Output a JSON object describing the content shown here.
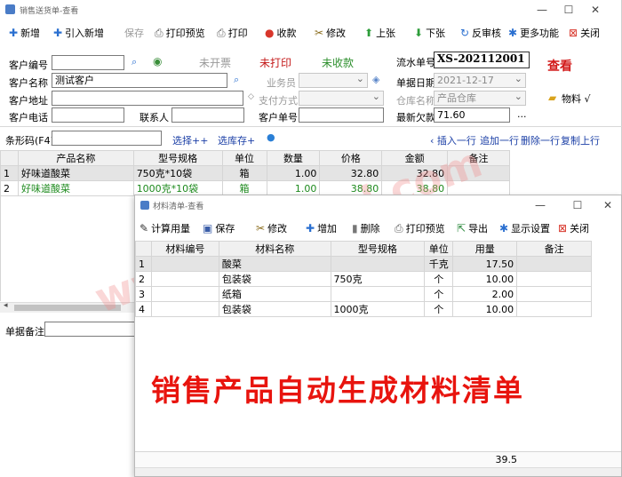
{
  "main_window": {
    "title": "销售送货单-查看",
    "toolbar": {
      "new": "新增",
      "import_new": "引入新增",
      "save": "保存",
      "print_preview": "打印预览",
      "print": "打印",
      "receive": "收款",
      "edit": "修改",
      "prev": "上张",
      "next": "下张",
      "unaudit": "反审核",
      "more": "更多功能",
      "close": "关闭"
    },
    "form": {
      "customer_code_label": "客户编号",
      "customer_code_value": "",
      "customer_name_label": "客户名称",
      "customer_name_value": "测试客户",
      "customer_addr_label": "客户地址",
      "customer_addr_value": "",
      "customer_phone_label": "客户电话",
      "customer_phone_value": "",
      "contact_label": "联系人",
      "contact_value": "",
      "invoice_status": "未开票",
      "print_status": "未打印",
      "receive_status": "未收款",
      "salesman_label": "业务员",
      "payment_label": "支付方式",
      "customer_order_label": "客户单号",
      "customer_order_value": "",
      "serial_label": "流水单号",
      "serial_value": "XS-202112001",
      "date_label": "单据日期",
      "date_value": "2021-12-17",
      "warehouse_label": "仓库名称",
      "warehouse_value": "产品仓库",
      "debt_label": "最新欠款",
      "debt_value": "71.60",
      "view_mode": "查看",
      "material_btn": "物料 √"
    },
    "barcode": {
      "label": "条形码(F4)",
      "value": "",
      "select": "选择++",
      "stock": "选库存+"
    },
    "row_actions": {
      "insert": "插入一行",
      "append": "追加一行",
      "delete": "删除一行",
      "copy": "复制上行"
    },
    "grid": {
      "columns": [
        "产品名称",
        "型号规格",
        "单位",
        "数量",
        "价格",
        "金额",
        "备注"
      ],
      "rows": [
        {
          "idx": "1",
          "name": "好味道酸菜",
          "spec": "750克*10袋",
          "unit": "箱",
          "qty": "1.00",
          "price": "32.80",
          "amount": "32.80",
          "note": ""
        },
        {
          "idx": "2",
          "name": "好味道酸菜",
          "spec": "1000克*10袋",
          "unit": "箱",
          "qty": "1.00",
          "price": "38.80",
          "amount": "38.80",
          "note": ""
        }
      ]
    },
    "remark_label": "单据备注",
    "remark_value": ""
  },
  "material_window": {
    "title": "材料清单-查看",
    "toolbar": {
      "calc": "计算用量",
      "save": "保存",
      "edit": "修改",
      "add": "增加",
      "delete": "删除",
      "print_preview": "打印预览",
      "export": "导出",
      "display": "显示设置",
      "close": "关闭"
    },
    "grid": {
      "columns": [
        "材料编号",
        "材料名称",
        "型号规格",
        "单位",
        "用量",
        "备注"
      ],
      "rows": [
        {
          "idx": "1",
          "code": "",
          "name": "酸菜",
          "spec": "",
          "unit": "千克",
          "qty": "17.50",
          "note": ""
        },
        {
          "idx": "2",
          "code": "",
          "name": "包装袋",
          "spec": "750克",
          "unit": "个",
          "qty": "10.00",
          "note": ""
        },
        {
          "idx": "3",
          "code": "",
          "name": "纸箱",
          "spec": "",
          "unit": "个",
          "qty": "2.00",
          "note": ""
        },
        {
          "idx": "4",
          "code": "",
          "name": "包装袋",
          "spec": "1000克",
          "unit": "个",
          "qty": "10.00",
          "note": ""
        }
      ],
      "total": "39.5"
    }
  },
  "caption": "销售产品自动生成材料清单",
  "watermark": "www.baoded.com"
}
